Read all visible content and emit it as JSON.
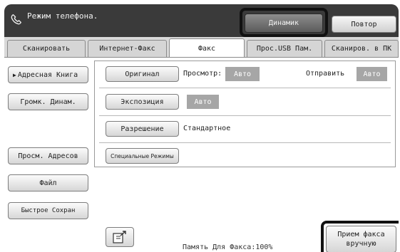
{
  "header": {
    "title": "Режим телефона.",
    "phone_icon": "phone-icon",
    "speaker_button": "Динамик",
    "redial_button": "Повтор"
  },
  "tabs": [
    {
      "label": "Сканировать",
      "active": false
    },
    {
      "label": "Интернет-Факс",
      "active": false
    },
    {
      "label": "Факс",
      "active": true
    },
    {
      "label": "Прос.USB Пам.",
      "active": false
    },
    {
      "label": "Сканиров. в ПК",
      "active": false
    }
  ],
  "sidebar": {
    "address_book": "Адресная Книга",
    "loud_speaker": "Громк. Динам.",
    "address_review": "Просм. Адресов",
    "file": "Файл",
    "quick_save": "Быстрое Сохран"
  },
  "settings": {
    "original_button": "Оригинал",
    "preview_label": "Просмотр:",
    "preview_value": "Авто",
    "send_label": "Отправить",
    "send_value": "Авто",
    "exposure_button": "Экспозиция",
    "exposure_value": "Авто",
    "resolution_button": "Разрешение",
    "resolution_value": "Стандартное",
    "special_modes_button": "Специальные Режимы"
  },
  "footer": {
    "memory_text": "Память Для Факса:100%",
    "manual_receive_line1": "Прием факса",
    "manual_receive_line2": "вручную",
    "export_icon": "export-icon"
  },
  "colors": {
    "titlebar": "#3a3a3a",
    "badge": "#a6a6a6",
    "highlight": "#111111"
  }
}
